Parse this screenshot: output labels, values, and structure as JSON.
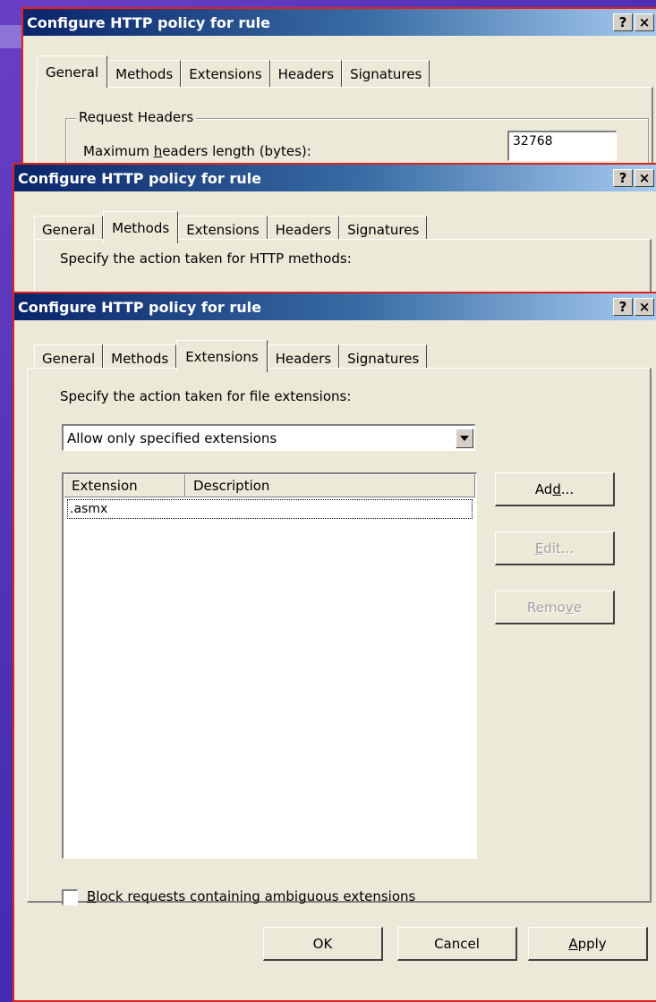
{
  "dialog1": {
    "title": "Configure HTTP policy for rule",
    "help": "?",
    "close": "×",
    "tabs": [
      "General",
      "Methods",
      "Extensions",
      "Headers",
      "Signatures"
    ],
    "active_tab": "General",
    "group_label": "Request Headers",
    "max_headers_label_pre": "Maximum ",
    "max_headers_label_ul": "h",
    "max_headers_label_post": "eaders length (bytes):",
    "max_headers_value": "32768"
  },
  "dialog2": {
    "title": "Configure HTTP policy for rule",
    "help": "?",
    "close": "×",
    "tabs": [
      "General",
      "Methods",
      "Extensions",
      "Headers",
      "Signatures"
    ],
    "active_tab": "Methods",
    "instruction": "Specify the action taken for HTTP methods:"
  },
  "dialog3": {
    "title": "Configure HTTP policy for rule",
    "help": "?",
    "close": "×",
    "tabs": [
      "General",
      "Methods",
      "Extensions",
      "Headers",
      "Signatures"
    ],
    "active_tab": "Extensions",
    "instruction": "Specify the action taken for file extensions:",
    "mode_select": "Allow only specified extensions",
    "columns": [
      "Extension",
      "Description"
    ],
    "rows": [
      ".asmx"
    ],
    "add_pre": "Ad",
    "add_ul": "d",
    "add_post": "...",
    "edit_ul": "E",
    "edit_post": "dit...",
    "remove_pre": "Remo",
    "remove_ul": "v",
    "remove_post": "e",
    "ambiguous_ul": "B",
    "ambiguous_post": "lock requests containing ambiguous extensions",
    "ok": "OK",
    "cancel": "Cancel",
    "apply_ul": "A",
    "apply_post": "pply"
  }
}
